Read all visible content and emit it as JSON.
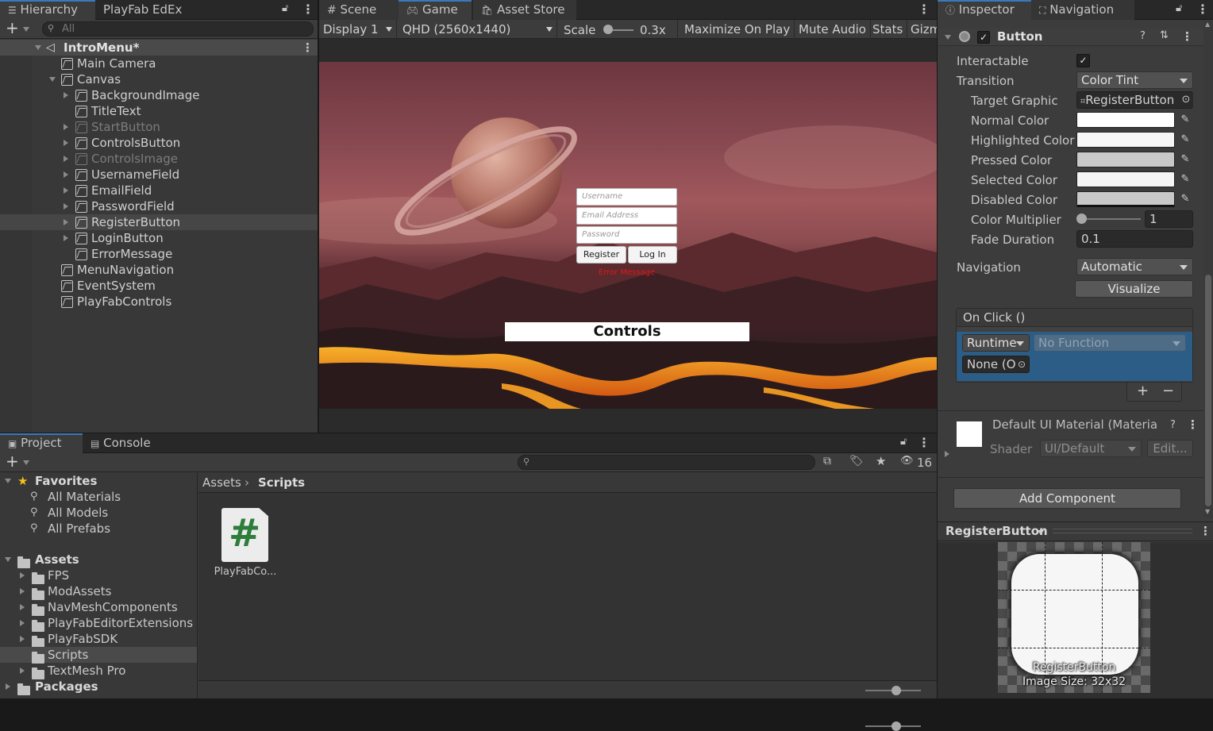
{
  "hierarchy": {
    "tabs": [
      "Hierarchy",
      "PlayFab EdEx"
    ],
    "search_placeholder": "All",
    "scene_name": "IntroMenu*",
    "items": [
      {
        "label": "Main Camera",
        "indent": 1,
        "expand": "none",
        "dim": false,
        "selected": false
      },
      {
        "label": "Canvas",
        "indent": 1,
        "expand": "open",
        "dim": false,
        "selected": false
      },
      {
        "label": "BackgroundImage",
        "indent": 2,
        "expand": "closed",
        "dim": false,
        "selected": false
      },
      {
        "label": "TitleText",
        "indent": 2,
        "expand": "none",
        "dim": false,
        "selected": false
      },
      {
        "label": "StartButton",
        "indent": 2,
        "expand": "closed",
        "dim": true,
        "selected": false
      },
      {
        "label": "ControlsButton",
        "indent": 2,
        "expand": "closed",
        "dim": false,
        "selected": false
      },
      {
        "label": "ControlsImage",
        "indent": 2,
        "expand": "closed",
        "dim": true,
        "selected": false
      },
      {
        "label": "UsernameField",
        "indent": 2,
        "expand": "closed",
        "dim": false,
        "selected": false
      },
      {
        "label": "EmailField",
        "indent": 2,
        "expand": "closed",
        "dim": false,
        "selected": false
      },
      {
        "label": "PasswordField",
        "indent": 2,
        "expand": "closed",
        "dim": false,
        "selected": false
      },
      {
        "label": "RegisterButton",
        "indent": 2,
        "expand": "closed",
        "dim": false,
        "selected": true
      },
      {
        "label": "LoginButton",
        "indent": 2,
        "expand": "closed",
        "dim": false,
        "selected": false
      },
      {
        "label": "ErrorMessage",
        "indent": 2,
        "expand": "none",
        "dim": false,
        "selected": false
      },
      {
        "label": "MenuNavigation",
        "indent": 1,
        "expand": "none",
        "dim": false,
        "selected": false
      },
      {
        "label": "EventSystem",
        "indent": 1,
        "expand": "none",
        "dim": false,
        "selected": false
      },
      {
        "label": "PlayFabControls",
        "indent": 1,
        "expand": "none",
        "dim": false,
        "selected": false
      }
    ]
  },
  "game": {
    "tabs": [
      "Scene",
      "Game",
      "Asset Store"
    ],
    "display": "Display 1",
    "resolution": "QHD (2560x1440)",
    "scale_label": "Scale",
    "scale_value": "0.3x",
    "buttons": [
      "Maximize On Play",
      "Mute Audio",
      "Stats",
      "Gizm"
    ],
    "ui": {
      "username_placeholder": "Username",
      "email_placeholder": "Email Address",
      "password_placeholder": "Password",
      "register": "Register",
      "login": "Log In",
      "error": "Error Message",
      "controls": "Controls"
    }
  },
  "inspector": {
    "tabs": [
      "Inspector",
      "Navigation"
    ],
    "component": "Button",
    "fields": {
      "interactable": "Interactable",
      "transition": "Transition",
      "transition_value": "Color Tint",
      "target_graphic": "Target Graphic",
      "target_graphic_value": "RegisterButton",
      "normal_color": "Normal Color",
      "highlighted_color": "Highlighted Color",
      "pressed_color": "Pressed Color",
      "selected_color": "Selected Color",
      "disabled_color": "Disabled Color",
      "color_multiplier": "Color Multiplier",
      "color_multiplier_value": "1",
      "fade_duration": "Fade Duration",
      "fade_duration_value": "0.1",
      "navigation": "Navigation",
      "navigation_value": "Automatic",
      "visualize": "Visualize"
    },
    "colors": {
      "normal": "#ffffff",
      "highlighted": "#f5f5f5",
      "pressed": "#c8c8c8",
      "selected": "#f5f5f5",
      "disabled": "#c8c8c8"
    },
    "onclick": {
      "header": "On Click ()",
      "runtime": "Runtime",
      "function": "No Function",
      "object": "None (O"
    },
    "material": {
      "name": "Default UI Material (Materia",
      "shader_label": "Shader",
      "shader_value": "UI/Default",
      "edit": "Edit..."
    },
    "add_component": "Add Component",
    "preview": {
      "title": "RegisterButton",
      "caption": "RegisterButton",
      "size": "Image Size: 32x32"
    }
  },
  "project": {
    "tabs": [
      "Project",
      "Console"
    ],
    "hidden_count": "16",
    "favorites_label": "Favorites",
    "favorites": [
      "All Materials",
      "All Models",
      "All Prefabs"
    ],
    "assets_label": "Assets",
    "folders": [
      {
        "label": "FPS",
        "expand": true,
        "selected": false
      },
      {
        "label": "ModAssets",
        "expand": true,
        "selected": false
      },
      {
        "label": "NavMeshComponents",
        "expand": true,
        "selected": false
      },
      {
        "label": "PlayFabEditorExtensions",
        "expand": true,
        "selected": false
      },
      {
        "label": "PlayFabSDK",
        "expand": true,
        "selected": false
      },
      {
        "label": "Scripts",
        "expand": false,
        "selected": true
      },
      {
        "label": "TextMesh Pro",
        "expand": true,
        "selected": false
      }
    ],
    "packages_label": "Packages",
    "breadcrumb": [
      "Assets",
      "Scripts"
    ],
    "files": [
      {
        "label": "PlayFabCo...",
        "glyph": "#"
      }
    ]
  }
}
